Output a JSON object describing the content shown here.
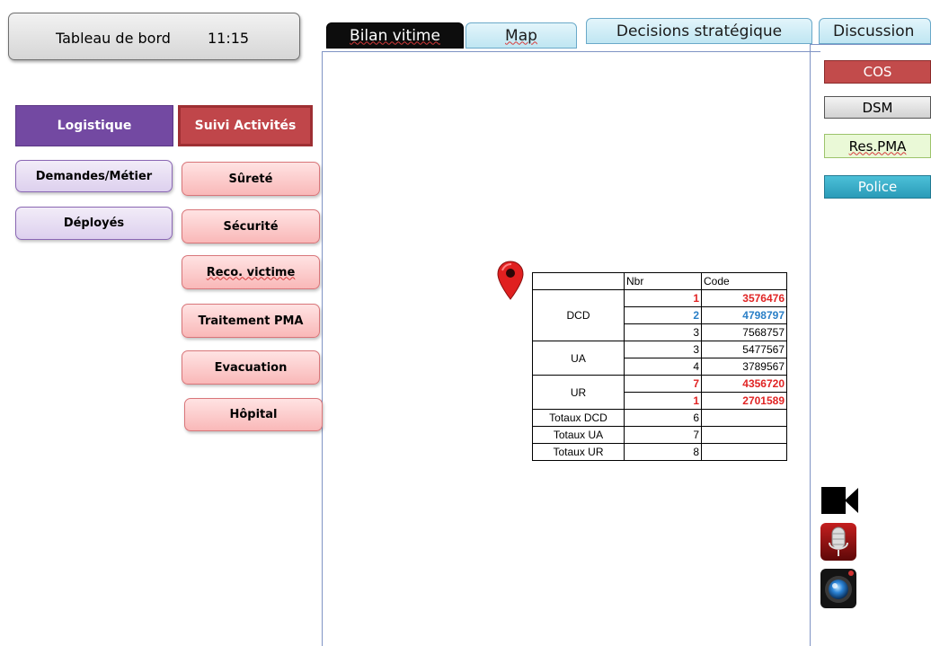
{
  "header": {
    "title": "Tableau de bord",
    "time": "11:15"
  },
  "tabs": [
    {
      "label": "Bilan vitime",
      "active": true
    },
    {
      "label": "Map",
      "active": false
    },
    {
      "label": "Decisions stratégique",
      "active": false
    },
    {
      "label": "Discussion",
      "active": false
    }
  ],
  "sidebar": {
    "logistique": {
      "label": "Logistique",
      "items": [
        {
          "label": "Demandes/Métier"
        },
        {
          "label": "Déployés"
        }
      ]
    },
    "suivi": {
      "label": "Suivi Activités",
      "items": [
        {
          "label": "Sûreté"
        },
        {
          "label": "Sécurité"
        },
        {
          "label": "Reco. victime"
        },
        {
          "label": "Traitement PMA"
        },
        {
          "label": "Evacuation"
        },
        {
          "label": "Hôpital"
        }
      ]
    }
  },
  "right_tags": [
    {
      "label": "COS"
    },
    {
      "label": "DSM"
    },
    {
      "label": "Res.PMA"
    },
    {
      "label": "Police"
    }
  ],
  "table": {
    "headers": [
      "",
      "Nbr",
      "Code"
    ],
    "groups": [
      {
        "label": "DCD",
        "rows": [
          {
            "nbr": "1",
            "code": "3576476",
            "color": "red"
          },
          {
            "nbr": "2",
            "code": "4798797",
            "color": "blue"
          },
          {
            "nbr": "3",
            "code": "7568757",
            "color": "plain"
          }
        ]
      },
      {
        "label": "UA",
        "rows": [
          {
            "nbr": "3",
            "code": "5477567",
            "color": "plain"
          },
          {
            "nbr": "4",
            "code": "3789567",
            "color": "plain"
          }
        ]
      },
      {
        "label": "UR",
        "rows": [
          {
            "nbr": "7",
            "code": "4356720",
            "color": "red"
          },
          {
            "nbr": "1",
            "code": "2701589",
            "color": "red"
          }
        ]
      }
    ],
    "totals": [
      {
        "label": "Totaux DCD",
        "value": "6"
      },
      {
        "label": "Totaux UA",
        "value": "7"
      },
      {
        "label": "Totaux UR",
        "value": "8"
      }
    ]
  },
  "icons": [
    "map-pin-icon",
    "video-camera-icon",
    "microphone-icon",
    "camera-lens-icon"
  ],
  "colors": {
    "logistique": "#7349a2",
    "suivi": "#c0464a",
    "cos": "#c24b4b",
    "police": "#2a9bb8",
    "code_red": "#e02424",
    "code_blue": "#2a7fc7"
  }
}
